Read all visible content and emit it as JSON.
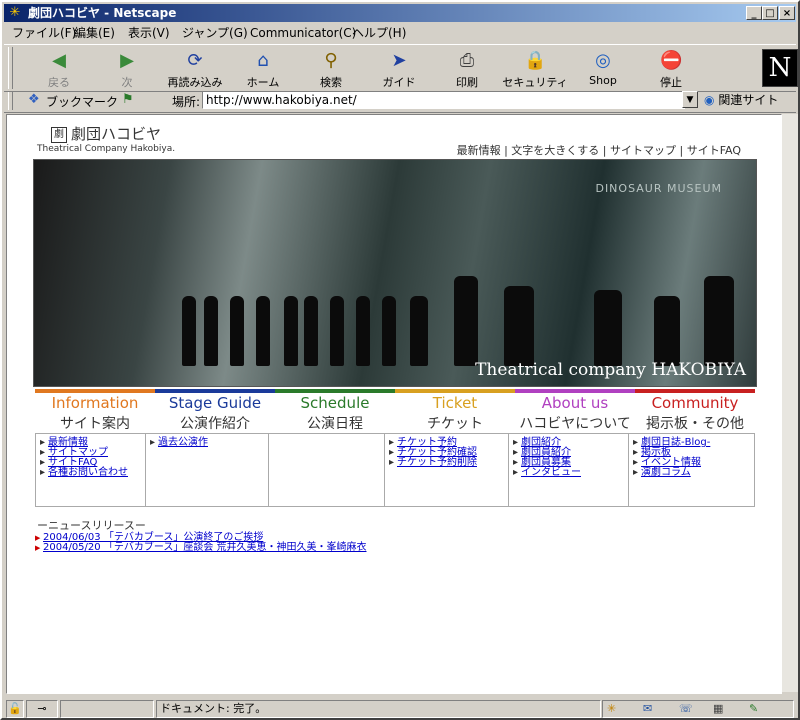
{
  "window": {
    "title": "劇団ハコビヤ - Netscape"
  },
  "menu": [
    "ファイル(F)",
    "編集(E)",
    "表示(V)",
    "ジャンプ(G)",
    "Communicator(C)",
    "ヘルプ(H)"
  ],
  "toolbar": [
    {
      "label": "戻る",
      "icon": "back-arrow-icon",
      "glyph": "◀",
      "enabled": false
    },
    {
      "label": "次",
      "icon": "forward-arrow-icon",
      "glyph": "▶",
      "enabled": false
    },
    {
      "label": "再読み込み",
      "icon": "reload-icon",
      "glyph": "⟳",
      "enabled": true
    },
    {
      "label": "ホーム",
      "icon": "home-icon",
      "glyph": "⌂",
      "enabled": true
    },
    {
      "label": "検索",
      "icon": "search-icon",
      "glyph": "⚲",
      "enabled": true
    },
    {
      "label": "ガイド",
      "icon": "guide-icon",
      "glyph": "➤",
      "enabled": true
    },
    {
      "label": "印刷",
      "icon": "print-icon",
      "glyph": "⎙",
      "enabled": true
    },
    {
      "label": "セキュリティ",
      "icon": "lock-icon",
      "glyph": "🔒",
      "enabled": true
    },
    {
      "label": "Shop",
      "icon": "shop-icon",
      "glyph": "◎",
      "enabled": true
    },
    {
      "label": "停止",
      "icon": "stop-icon",
      "glyph": "⛔",
      "enabled": true
    }
  ],
  "location": {
    "bookmark_label": "ブックマーク",
    "label": "場所:",
    "url": "http://www.hakobiya.net/",
    "related": "関連サイト"
  },
  "site": {
    "logo": "劇団ハコビヤ",
    "logo_mark": "劇",
    "logo_sub": "Theatrical Company Hakobiya.",
    "top_links": "最新情報 | 文字を大きくする | サイトマップ | サイトFAQ",
    "hero_caption": "Theatrical company HAKOBIYA",
    "hero_backdrop": "DINOSAUR MUSEUM",
    "nav": [
      {
        "en": "Information",
        "jp": "サイト案内",
        "color": "#e07820"
      },
      {
        "en": "Stage Guide",
        "jp": "公演作紹介",
        "color": "#1a3a9a"
      },
      {
        "en": "Schedule",
        "jp": "公演日程",
        "color": "#2a7a2a"
      },
      {
        "en": "Ticket",
        "jp": "チケット",
        "color": "#d8a020"
      },
      {
        "en": "About us",
        "jp": "ハコビヤについて",
        "color": "#b040c0"
      },
      {
        "en": "Community",
        "jp": "掲示板・その他",
        "color": "#c82020"
      }
    ],
    "subs": [
      [
        "最新情報",
        "サイトマップ",
        "サイトFAQ",
        "各種お問い合わせ"
      ],
      [
        "過去公演作"
      ],
      [],
      [
        "チケット予約",
        "チケット予約確認",
        "チケット予約削除"
      ],
      [
        "劇団紹介",
        "劇団員紹介",
        "劇団員募集",
        "インタビュー"
      ],
      [
        "劇団日誌-Blog-",
        "掲示板",
        "イベント情報",
        "演劇コラム"
      ]
    ],
    "news_heading": "ーニュースリリースー",
    "news": [
      "2004/06/03 「テバカブース」公演終了のご挨拶",
      "2004/05/20 「テバカブース」座談会 荒井久美恵・神田久美・峯崎麻衣"
    ]
  },
  "status": {
    "text": "ドキュメント: 完了。"
  }
}
